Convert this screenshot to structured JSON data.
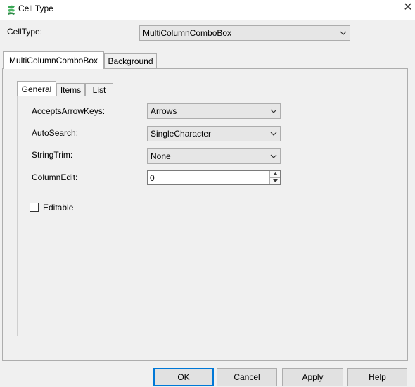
{
  "window": {
    "title": "Cell Type",
    "close_glyph": "✕"
  },
  "celltype": {
    "label": "CellType:",
    "value": "MultiColumnComboBox"
  },
  "outer_tabs": [
    {
      "label": "MultiColumnComboBox",
      "active": true
    },
    {
      "label": "Background",
      "active": false
    }
  ],
  "inner_tabs": [
    {
      "label": "General",
      "active": true
    },
    {
      "label": "Items",
      "active": false
    },
    {
      "label": "List",
      "active": false
    }
  ],
  "general": {
    "accepts_arrow_keys": {
      "label": "AcceptsArrowKeys:",
      "value": "Arrows"
    },
    "auto_search": {
      "label": "AutoSearch:",
      "value": "SingleCharacter"
    },
    "string_trim": {
      "label": "StringTrim:",
      "value": "None"
    },
    "column_edit": {
      "label": "ColumnEdit:",
      "value": "0"
    },
    "editable": {
      "label": "Editable",
      "checked": false
    }
  },
  "buttons": {
    "ok": "OK",
    "cancel": "Cancel",
    "apply": "Apply",
    "help": "Help"
  },
  "colors": {
    "accent": "#0078d7",
    "icon_green": "#3aa655"
  }
}
